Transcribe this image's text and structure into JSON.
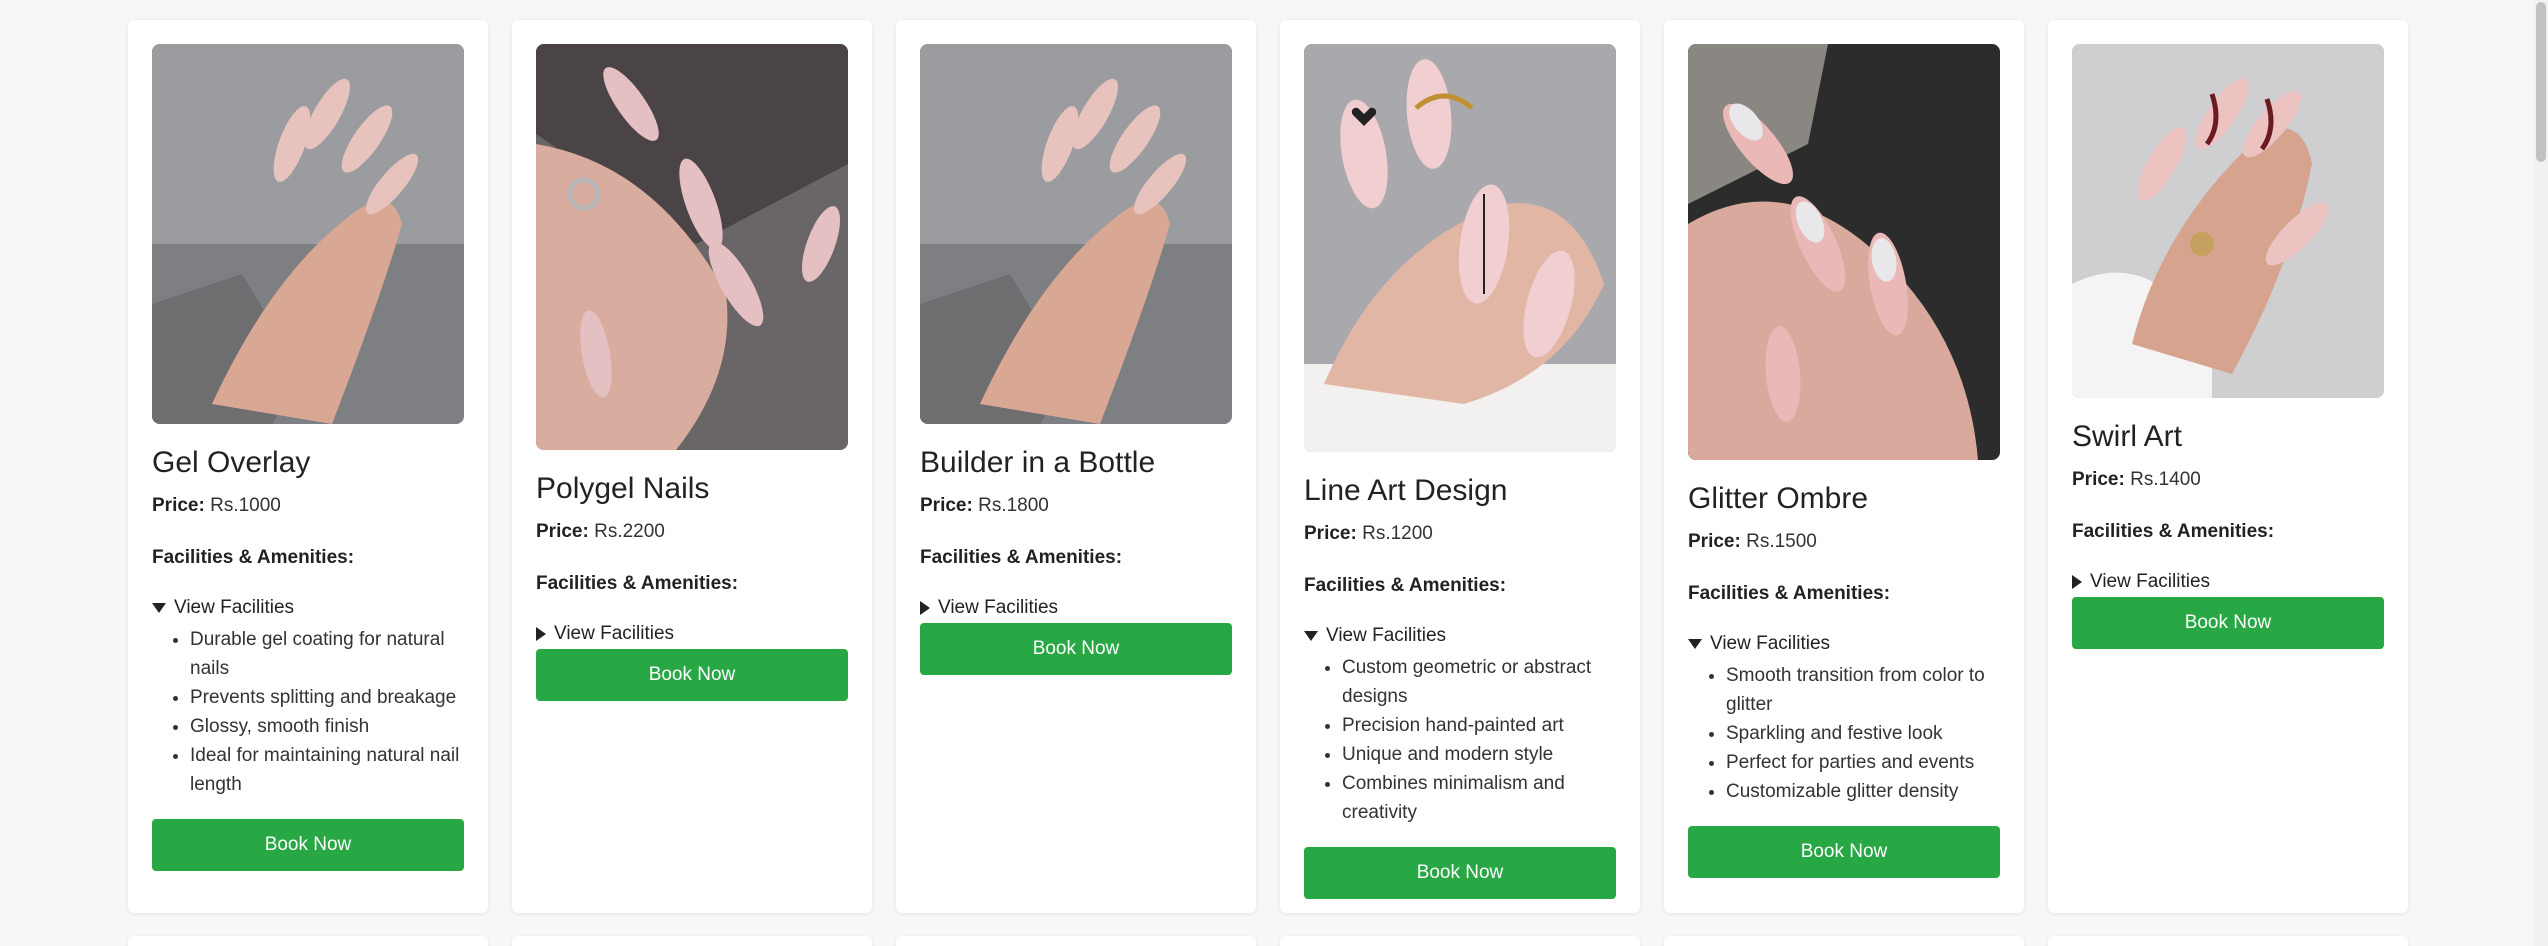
{
  "services": [
    {
      "title": "Gel Overlay",
      "price_label": "Price:",
      "price_value": "Rs.1000",
      "facilities_heading": "Facilities & Amenities:",
      "toggle_label": "View Facilities",
      "expanded": true,
      "facilities": [
        "Durable gel coating for natural nails",
        "Prevents splitting and breakage",
        "Glossy, smooth finish",
        "Ideal for maintaining natural nail length"
      ],
      "button_label": "Book Now"
    },
    {
      "title": "Polygel Nails",
      "price_label": "Price:",
      "price_value": "Rs.2200",
      "facilities_heading": "Facilities & Amenities:",
      "toggle_label": "View Facilities",
      "expanded": false,
      "facilities": [],
      "button_label": "Book Now"
    },
    {
      "title": "Builder in a Bottle",
      "price_label": "Price:",
      "price_value": "Rs.1800",
      "facilities_heading": "Facilities & Amenities:",
      "toggle_label": "View Facilities",
      "expanded": false,
      "facilities": [],
      "button_label": "Book Now"
    },
    {
      "title": "Line Art Design",
      "price_label": "Price:",
      "price_value": "Rs.1200",
      "facilities_heading": "Facilities & Amenities:",
      "toggle_label": "View Facilities",
      "expanded": true,
      "facilities": [
        "Custom geometric or abstract designs",
        "Precision hand-painted art",
        "Unique and modern style",
        "Combines minimalism and creativity"
      ],
      "button_label": "Book Now"
    },
    {
      "title": "Glitter Ombre",
      "price_label": "Price:",
      "price_value": "Rs.1500",
      "facilities_heading": "Facilities & Amenities:",
      "toggle_label": "View Facilities",
      "expanded": true,
      "facilities": [
        "Smooth transition from color to glitter",
        "Sparkling and festive look",
        "Perfect for parties and events",
        "Customizable glitter density"
      ],
      "button_label": "Book Now"
    },
    {
      "title": "Swirl Art",
      "price_label": "Price:",
      "price_value": "Rs.1400",
      "facilities_heading": "Facilities & Amenities:",
      "toggle_label": "View Facilities",
      "expanded": false,
      "facilities": [],
      "button_label": "Book Now"
    }
  ],
  "colors": {
    "book_button": "#28a745",
    "card_background": "#ffffff",
    "page_background": "#f7f7f7"
  }
}
